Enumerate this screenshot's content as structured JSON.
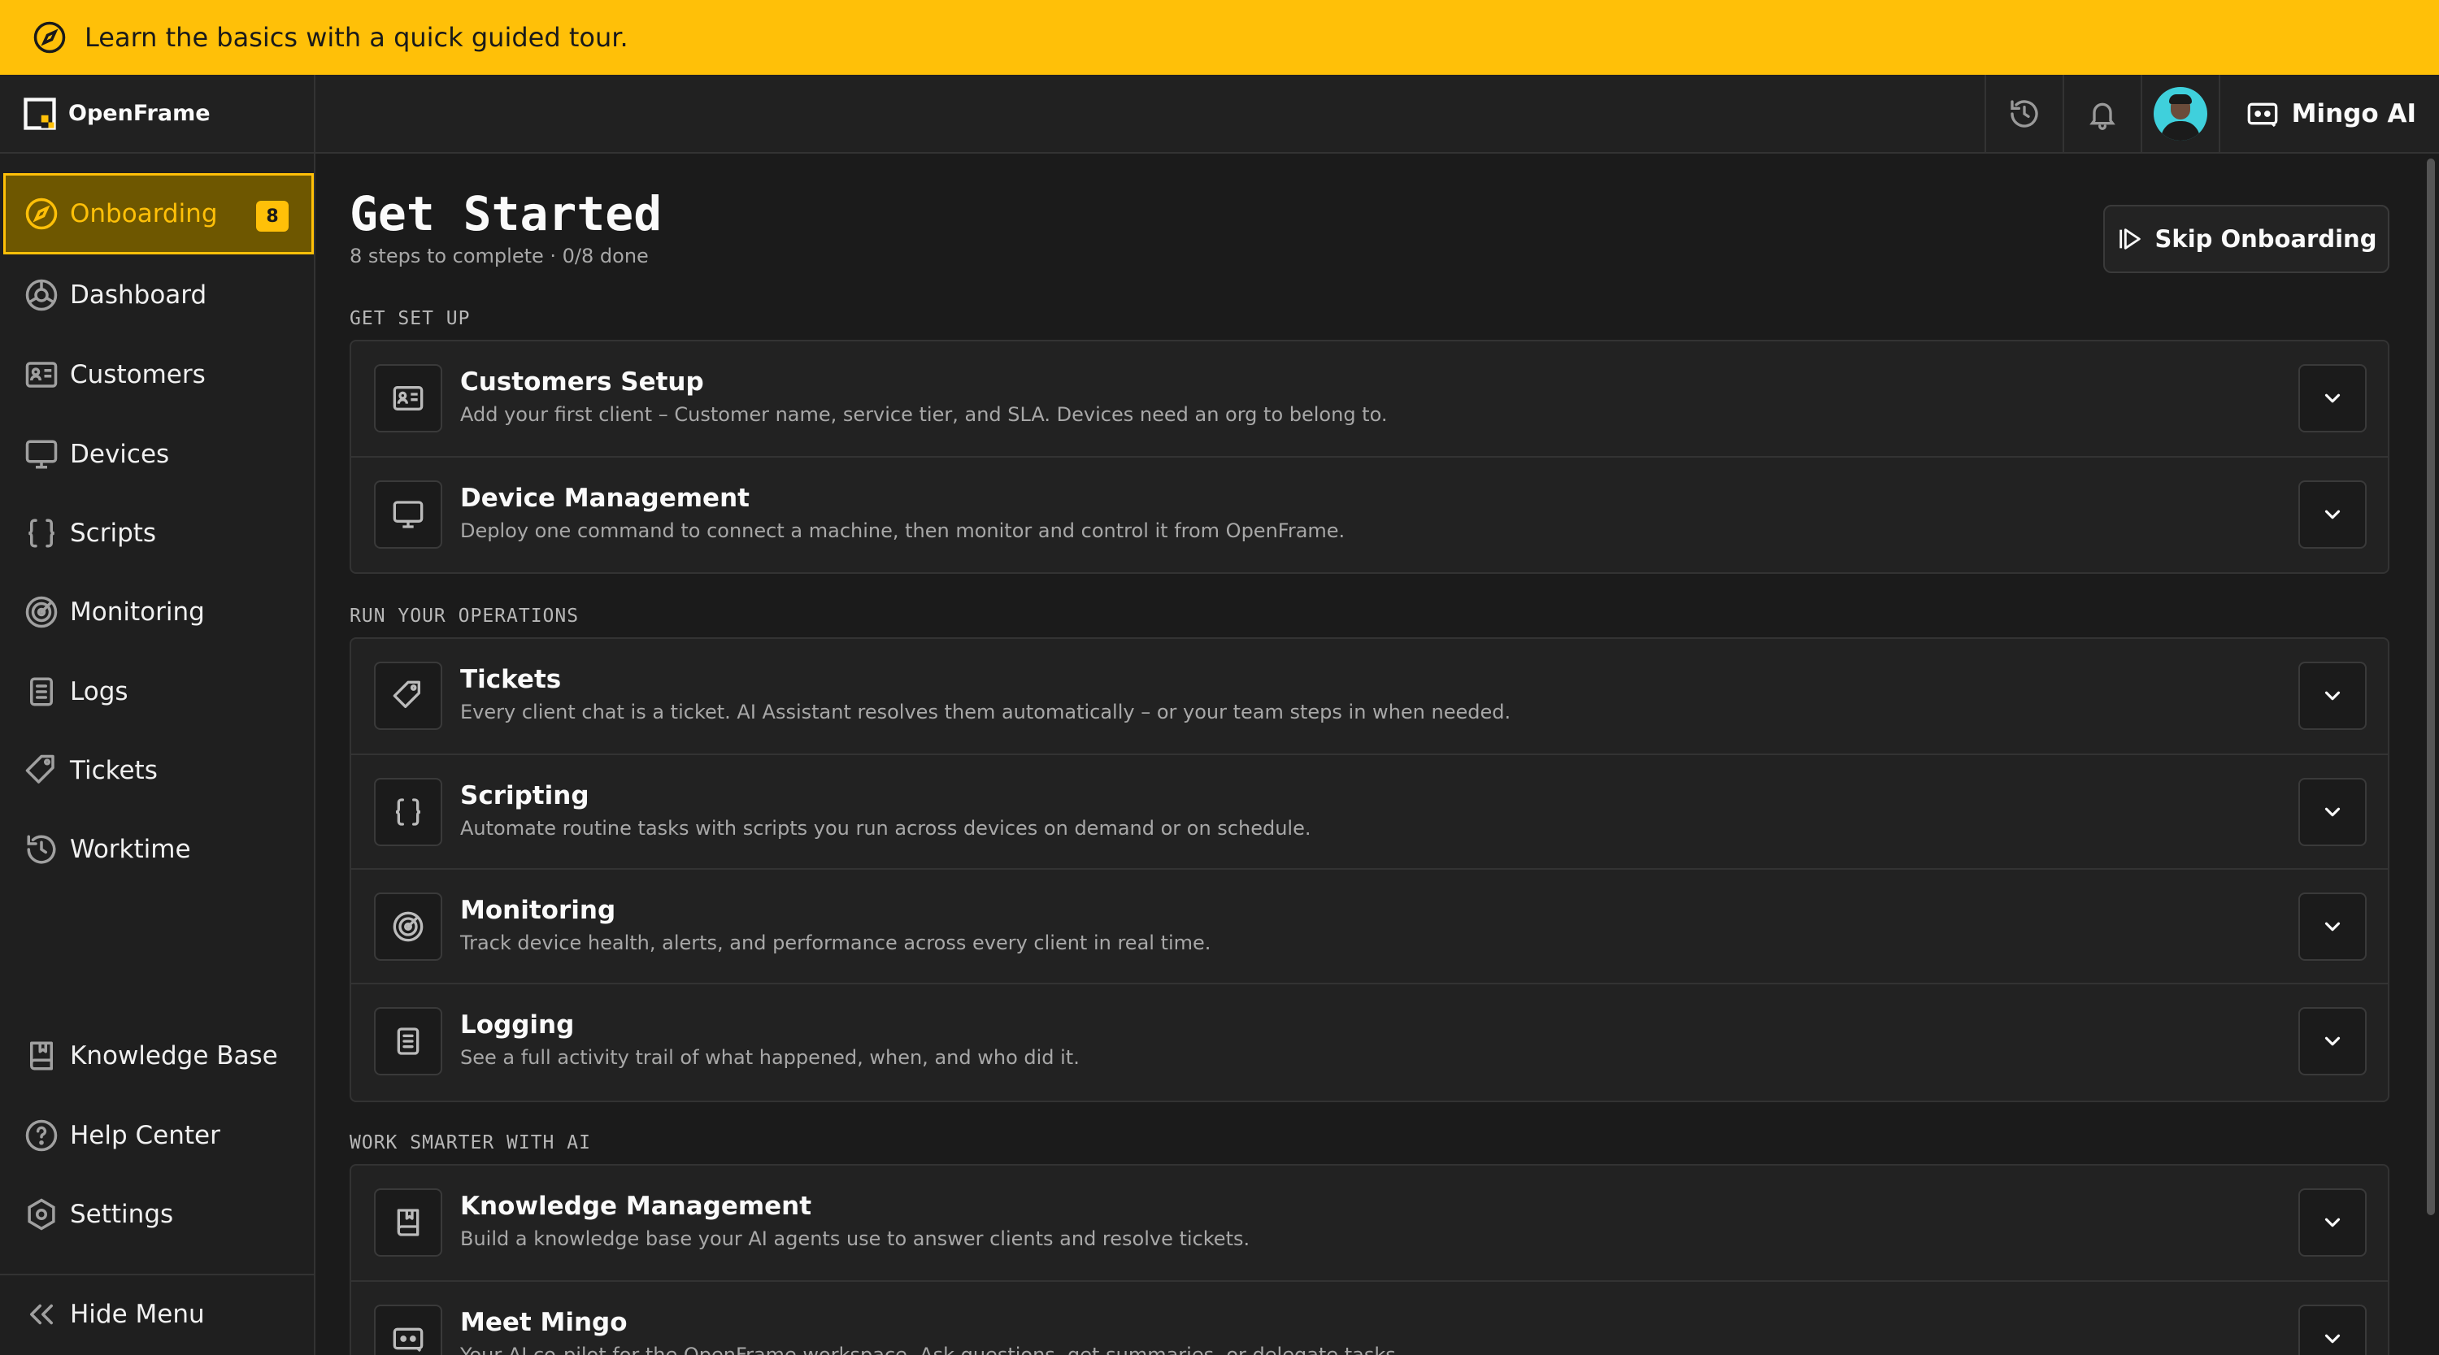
{
  "banner": {
    "text": "Learn the basics with a quick guided tour."
  },
  "brand": {
    "name": "OpenFrame"
  },
  "topbar": {
    "assistant_label": "Mingo AI"
  },
  "sidebar": {
    "items": [
      {
        "label": "Onboarding",
        "badge": "8"
      },
      {
        "label": "Dashboard"
      },
      {
        "label": "Customers"
      },
      {
        "label": "Devices"
      },
      {
        "label": "Scripts"
      },
      {
        "label": "Monitoring"
      },
      {
        "label": "Logs"
      },
      {
        "label": "Tickets"
      },
      {
        "label": "Worktime"
      }
    ],
    "footer_items": [
      {
        "label": "Knowledge Base"
      },
      {
        "label": "Help Center"
      },
      {
        "label": "Settings"
      }
    ],
    "hide_menu": "Hide Menu"
  },
  "main": {
    "title": "Get Started",
    "subtitle": "8 steps to complete · 0/8 done",
    "skip_label": "Skip Onboarding",
    "sections": [
      {
        "header": "GET SET UP",
        "cards": [
          {
            "title": "Customers Setup",
            "desc": "Add your first client – Customer name, service tier, and SLA. Devices need an org to belong to."
          },
          {
            "title": "Device Management",
            "desc": "Deploy one command to connect a machine, then monitor and control it from OpenFrame."
          }
        ]
      },
      {
        "header": "RUN YOUR OPERATIONS",
        "cards": [
          {
            "title": "Tickets",
            "desc": "Every client chat is a ticket. AI Assistant resolves them automatically – or your team steps in when needed."
          },
          {
            "title": "Scripting",
            "desc": "Automate routine tasks with scripts you run across devices on demand or on schedule."
          },
          {
            "title": "Monitoring",
            "desc": "Track device health, alerts, and performance across every client in real time."
          },
          {
            "title": "Logging",
            "desc": "See a full activity trail of what happened, when, and who did it."
          }
        ]
      },
      {
        "header": "WORK SMARTER WITH AI",
        "cards": [
          {
            "title": "Knowledge Management",
            "desc": "Build a knowledge base your AI agents use to answer clients and resolve tickets."
          },
          {
            "title": "Meet Mingo",
            "desc": "Your AI co-pilot for the OpenFrame workspace. Ask questions, get summaries, or delegate tasks."
          }
        ]
      }
    ]
  },
  "colors": {
    "accent": "#ffc008",
    "background": "#1b1b1b",
    "card": "#222222"
  }
}
